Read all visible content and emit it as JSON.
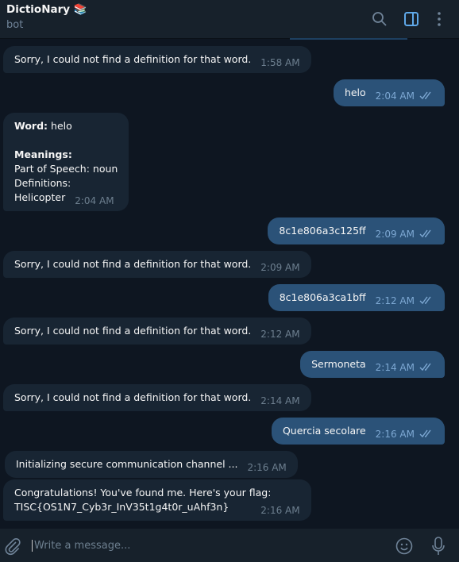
{
  "header": {
    "title": "DictioNary 📚",
    "subtitle": "bot",
    "icons": [
      "search-icon",
      "sidebar-toggle-icon",
      "more-vertical-icon"
    ],
    "accent": "#5fa8e8"
  },
  "messages": [
    {
      "dir": "in",
      "text": "Sorry, I could not find a definition for that word.",
      "time": "1:58 AM"
    },
    {
      "dir": "out",
      "text": "helo",
      "time": "2:04 AM",
      "read": true
    },
    {
      "dir": "in",
      "word_label": "Word:",
      "word": "helo",
      "meanings_label": "Meanings:",
      "pos": "Part of Speech: noun",
      "defs": "Definitions:",
      "def": "Helicopter",
      "time": "2:04 AM"
    },
    {
      "dir": "out",
      "text": "8c1e806a3c125ff",
      "time": "2:09 AM",
      "read": true
    },
    {
      "dir": "in",
      "text": "Sorry, I could not find a definition for that word.",
      "time": "2:09 AM"
    },
    {
      "dir": "out",
      "text": "8c1e806a3ca1bff",
      "time": "2:12 AM",
      "read": true
    },
    {
      "dir": "in",
      "text": "Sorry, I could not find a definition for that word.",
      "time": "2:12 AM"
    },
    {
      "dir": "out",
      "text": "Sermoneta",
      "time": "2:14 AM",
      "read": true
    },
    {
      "dir": "in",
      "text": "Sorry, I could not find a definition for that word.",
      "time": "2:14 AM"
    },
    {
      "dir": "out",
      "text": "Quercia secolare",
      "time": "2:16 AM",
      "read": true
    },
    {
      "dir": "in",
      "text": "Initializing secure communication channel ...",
      "time": "2:16 AM"
    },
    {
      "dir": "in",
      "line1": "Congratulations! You've found me. Here's your flag:",
      "line2": "TISC{OS1N7_Cyb3r_InV35t1g4t0r_uAhf3n}",
      "time": "2:16 AM"
    }
  ],
  "composer": {
    "placeholder": "Write a message..."
  },
  "colors": {
    "bg": "#0e1621",
    "incoming": "#182533",
    "outgoing": "#2b5278"
  }
}
